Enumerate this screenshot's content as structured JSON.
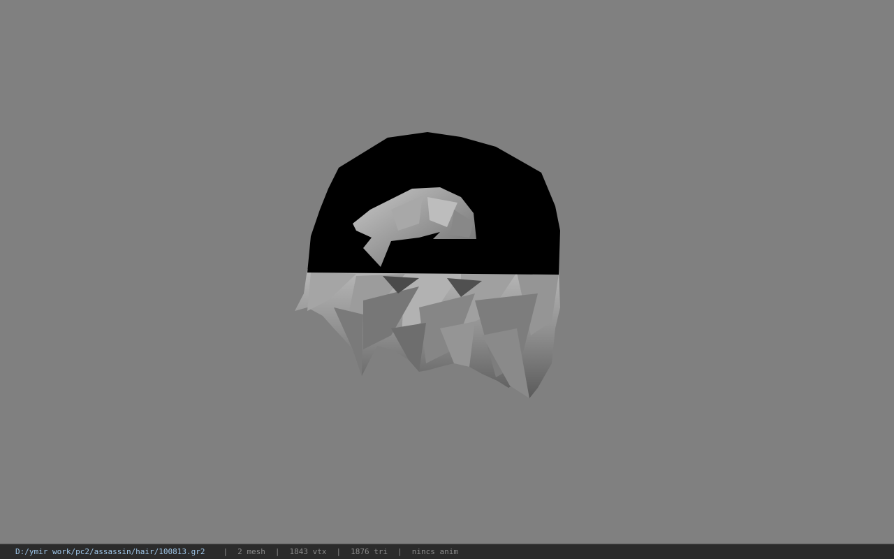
{
  "viewport": {
    "background_color": "#808080",
    "model": {
      "cap_color": "#000000",
      "hair_color": "#9a9a9a",
      "icon": "hair-cap-model"
    }
  },
  "status_bar": {
    "file_path": "D:/ymir work/pc2/assassin/hair/100813.gr2",
    "separator": "|",
    "mesh_count": "2 mesh",
    "vertex_count": "1843 vtx",
    "triangle_count": "1876 tri",
    "animation_status": "nincs anim",
    "path_color": "#9fc6e8",
    "text_color": "#8a8a8a"
  }
}
